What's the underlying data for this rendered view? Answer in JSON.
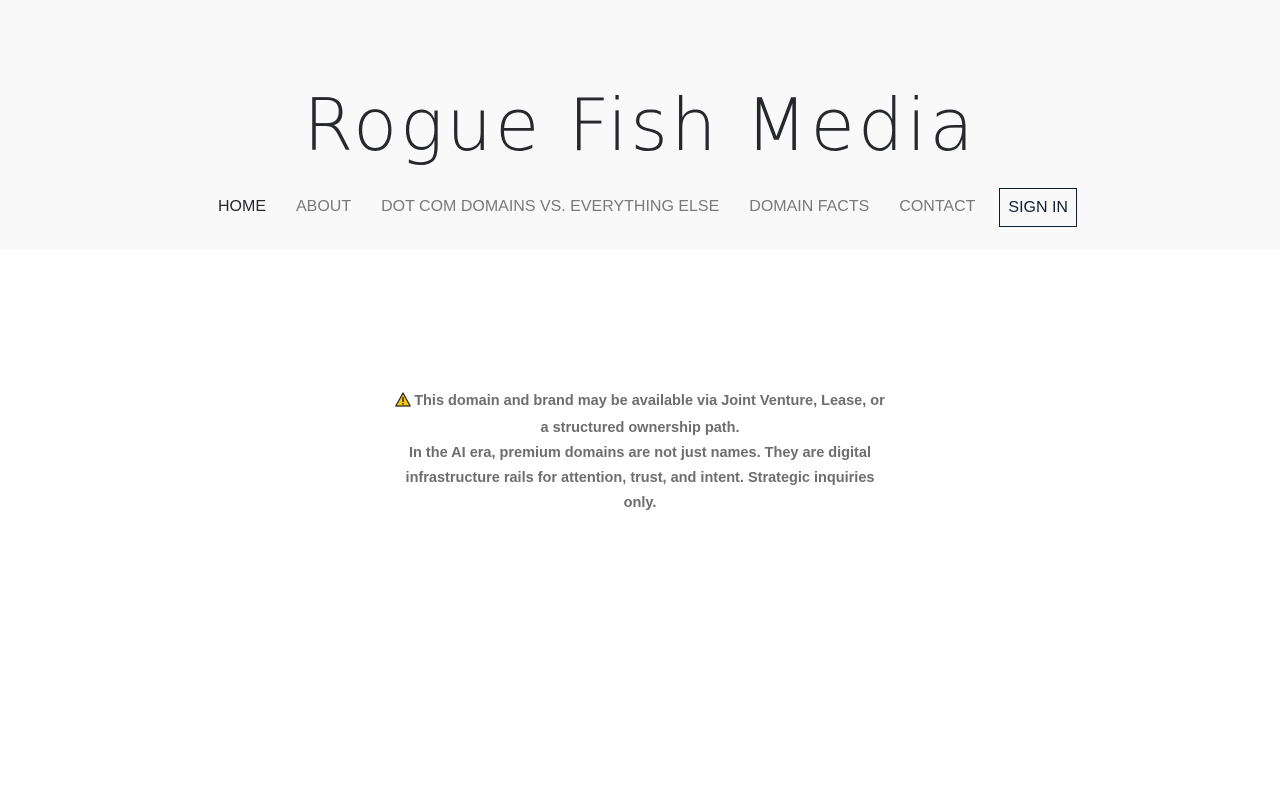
{
  "site": {
    "title": "Rogue Fish Media"
  },
  "nav": {
    "items": [
      {
        "label": "HOME",
        "active": true
      },
      {
        "label": "ABOUT"
      },
      {
        "label": "DOT COM DOMAINS VS. EVERYTHING ELSE"
      },
      {
        "label": "DOMAIN FACTS"
      },
      {
        "label": "CONTACT"
      }
    ],
    "sign_in_label": "SIGN IN"
  },
  "notice": {
    "icon": "warning-icon",
    "line1": "This domain and brand may be available via Joint Venture, Lease, or a structured ownership path.",
    "line2": "In the AI era, premium domains are not just names. They are digital infrastructure rails for attention, trust, and intent. Strategic inquiries only."
  },
  "colors": {
    "header_bg": "#f9f9f9",
    "title": "#26282c",
    "nav_text": "#7a7a7a",
    "sign_in": "#0f1c35",
    "warning_fill": "#f5c518"
  }
}
